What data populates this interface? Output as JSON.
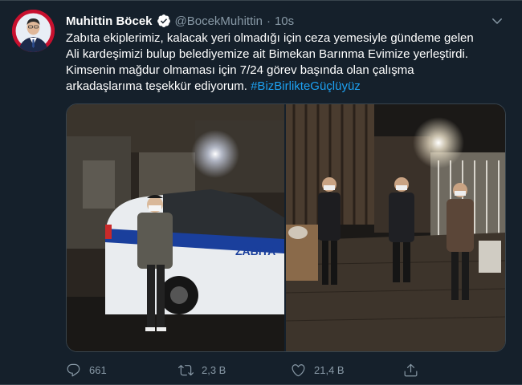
{
  "tweet": {
    "author": {
      "name": "Muhittin Böcek",
      "handle": "@BocekMuhittin",
      "verified": true,
      "avatar_icon": "user-avatar"
    },
    "separator": "·",
    "time": "10s",
    "text_lines": [
      "Zabıta ekiplerimiz, kalacak yeri olmadığı için ceza yemesiyle gündeme gelen",
      "Ali kardeşimizi bulup belediyemize ait Bimekan Barınma Evimize yerleştirdi.",
      "Kimsenin mağdur olmaması için 7/24 görev başında olan çalışma",
      "arkadaşlarıma teşekkür ediyorum. "
    ],
    "hashtag": "#BizBirlikteGüçlüyüz",
    "media": {
      "left_photo_vehicle_text": "ZABITA"
    },
    "actions": {
      "reply_count": "661",
      "retweet_count": "2,3 B",
      "like_count": "21,4 B"
    }
  },
  "colors": {
    "background": "#15202b",
    "border": "#38444d",
    "accent": "#1da1f2",
    "secondary_text": "#8899a6"
  },
  "icons": [
    "verified-badge-icon",
    "chevron-down-icon",
    "reply-icon",
    "retweet-icon",
    "like-icon",
    "share-icon"
  ]
}
